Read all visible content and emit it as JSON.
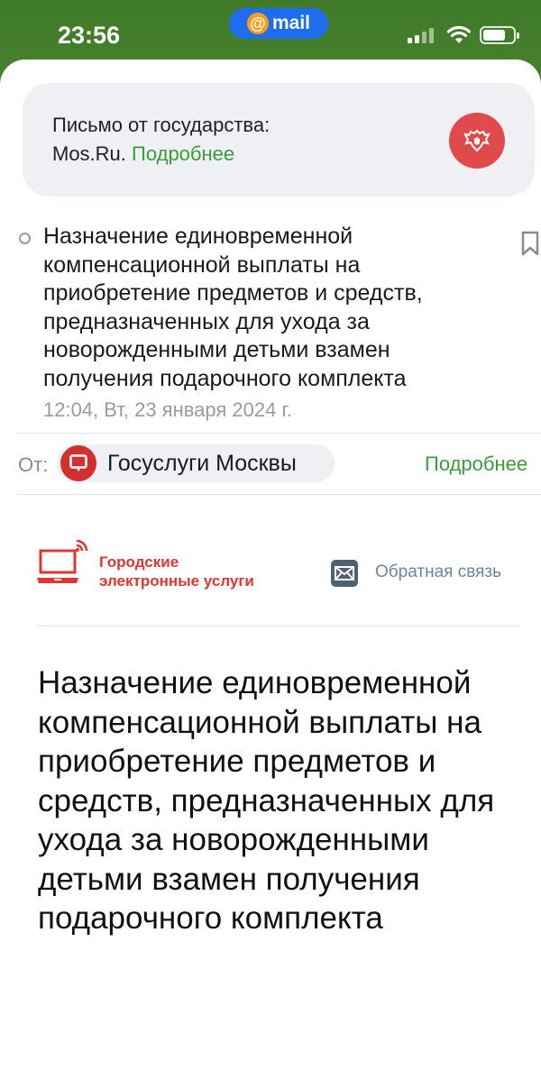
{
  "status_bar": {
    "time": "23:56",
    "app_badge": "mail",
    "icons": [
      "cellular-signal-icon",
      "wifi-icon",
      "battery-icon"
    ]
  },
  "gov_banner": {
    "line1": "Письмо от государства:",
    "source": "Mos.Ru.",
    "more_label": "Подробнее",
    "emblem_icon": "russian-coat-of-arms-icon",
    "emblem_color": "#e04a4a"
  },
  "message": {
    "subject": "Назначение единовременной компенсационной выплаты на приобретение предметов и средств, предназначенных для ухода за новорожденными детьми взамен получения подарочного комплекта",
    "date": "12:04, Вт, 23 января 2024 г.",
    "from_label": "От:",
    "sender_name": "Госуслуги Москвы",
    "more_label": "Подробнее"
  },
  "body": {
    "logo_line1": "Городские",
    "logo_line2": "электронные услуги",
    "feedback_label": "Обратная связь",
    "title": "Назначение единовременной компенсационной выплаты на приобретение предметов и средств, предназначенных для ухода за новорожденными детьми взамен получения подарочного комплекта"
  },
  "colors": {
    "accent_green": "#3b9c3b",
    "brand_red": "#e03531",
    "pill_blue": "#1e6cf0"
  }
}
